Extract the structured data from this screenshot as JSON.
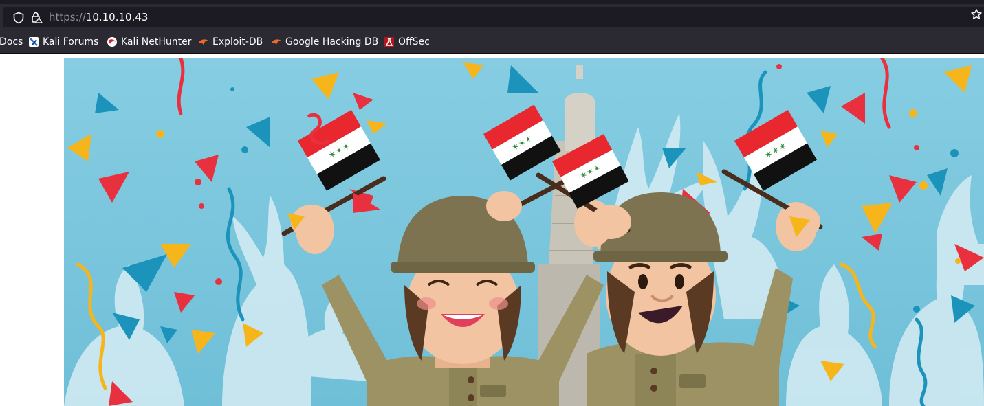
{
  "browser": {
    "url_scheme": "https://",
    "url_host": "10.10.10.43"
  },
  "bookmarks": [
    {
      "label": "Docs",
      "icon": "kali-docs-icon"
    },
    {
      "label": "Kali Forums",
      "icon": "kali-forums-icon"
    },
    {
      "label": "Kali NetHunter",
      "icon": "kali-nethunter-icon"
    },
    {
      "label": "Exploit-DB",
      "icon": "exploit-db-icon"
    },
    {
      "label": "Google Hacking DB",
      "icon": "ghdb-icon"
    },
    {
      "label": "OffSec",
      "icon": "offsec-icon"
    }
  ],
  "colors": {
    "toolbar": "#2b2a33",
    "urlbar": "#1c1b22",
    "sky": "#7cc6dd",
    "flag_red": "#e8272f",
    "flag_black": "#111111",
    "helmet": "#7d7350",
    "uniform": "#9c9263"
  }
}
